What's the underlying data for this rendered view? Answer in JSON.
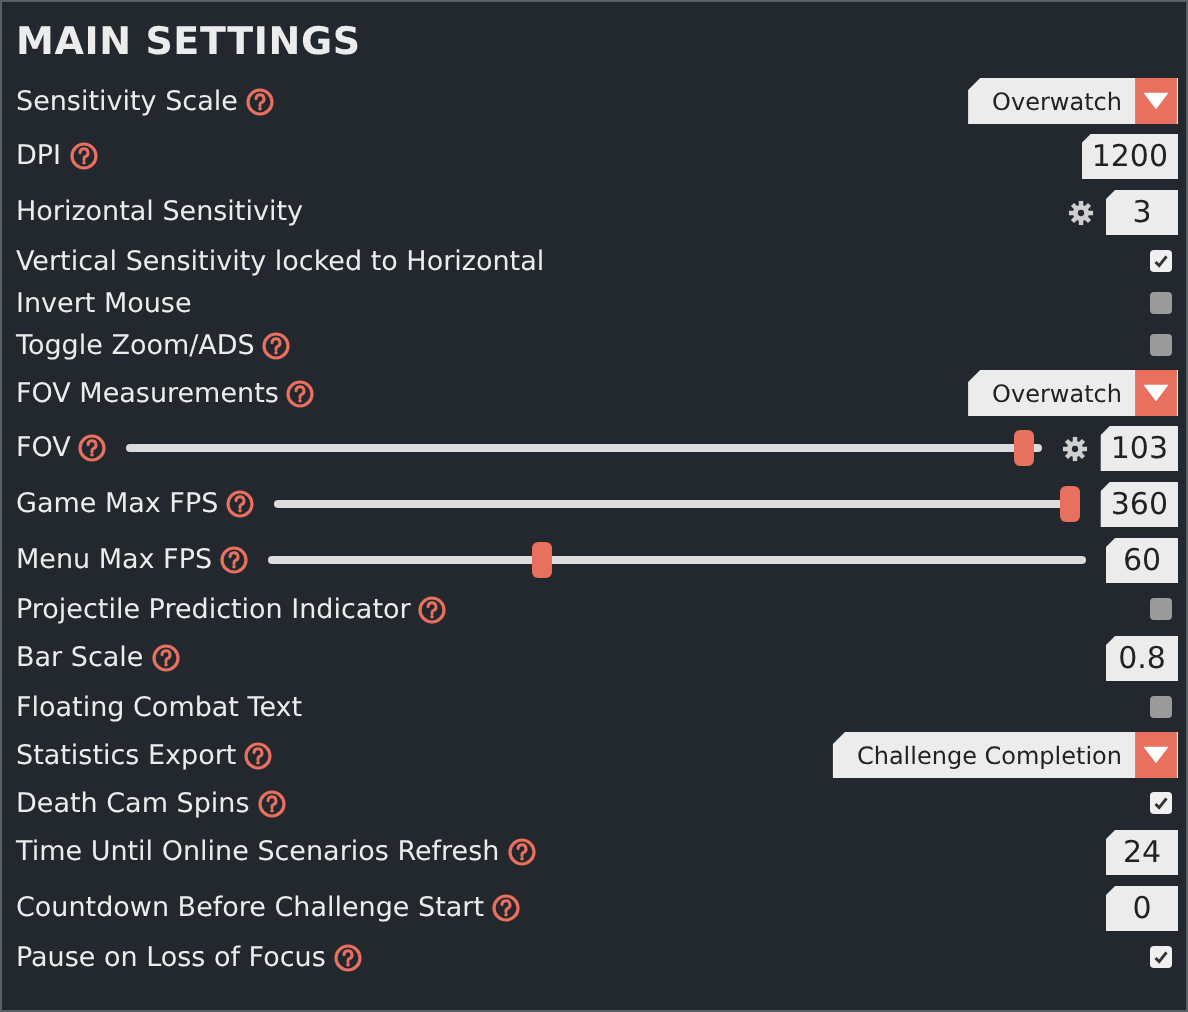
{
  "title": "MAIN SETTINGS",
  "settings": [
    {
      "kind": "dropdown",
      "label": "Sensitivity Scale",
      "help": true,
      "value": "Overwatch"
    },
    {
      "kind": "number",
      "label": "DPI",
      "help": true,
      "value": "1200"
    },
    {
      "kind": "number",
      "label": "Horizontal Sensitivity",
      "help": false,
      "gear": true,
      "value": "3"
    },
    {
      "kind": "checkbox",
      "label": "Vertical Sensitivity locked to Horizontal",
      "help": false,
      "checked": true
    },
    {
      "kind": "checkbox",
      "label": "Invert Mouse",
      "help": false,
      "checked": false
    },
    {
      "kind": "checkbox",
      "label": "Toggle Zoom/ADS",
      "help": true,
      "checked": false
    },
    {
      "kind": "dropdown",
      "label": "FOV Measurements",
      "help": true,
      "value": "Overwatch"
    },
    {
      "kind": "slider",
      "label": "FOV",
      "help": true,
      "gear": true,
      "level": 0.99,
      "value": "103"
    },
    {
      "kind": "slider",
      "label": "Game Max FPS",
      "help": true,
      "level": 1,
      "value": "360"
    },
    {
      "kind": "slider",
      "label": "Menu Max FPS",
      "help": true,
      "level": 0.33,
      "value": "60"
    },
    {
      "kind": "checkbox",
      "label": "Projectile Prediction Indicator",
      "help": true,
      "checked": false
    },
    {
      "kind": "number",
      "label": "Bar Scale",
      "help": true,
      "value": "0.8"
    },
    {
      "kind": "checkbox",
      "label": "Floating Combat Text",
      "help": false,
      "checked": false
    },
    {
      "kind": "dropdown",
      "label": "Statistics Export",
      "help": true,
      "value": "Challenge Completion"
    },
    {
      "kind": "checkbox",
      "label": "Death Cam Spins",
      "help": true,
      "checked": true
    },
    {
      "kind": "number",
      "label": "Time Until Online Scenarios Refresh",
      "help": true,
      "value": "24"
    },
    {
      "kind": "number",
      "label": "Countdown Before Challenge Start",
      "help": true,
      "value": "0"
    },
    {
      "kind": "checkbox",
      "label": "Pause on Loss of Focus",
      "help": true,
      "checked": true
    }
  ]
}
